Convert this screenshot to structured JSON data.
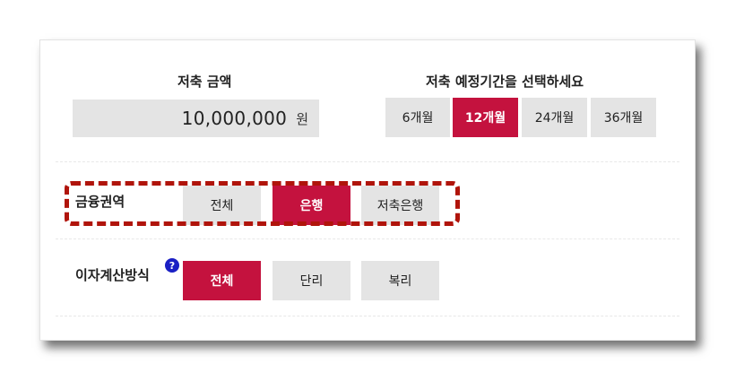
{
  "amount_section": {
    "title": "저축 금액",
    "value": "10,000,000",
    "unit": "원"
  },
  "period_section": {
    "title": "저축 예정기간을 선택하세요",
    "options": [
      "6개월",
      "12개월",
      "24개월",
      "36개월"
    ],
    "selected": "12개월"
  },
  "finance_area": {
    "label": "금융권역",
    "options": [
      "전체",
      "은행",
      "저축은행"
    ],
    "selected": "은행"
  },
  "interest_method": {
    "label": "이자계산방식",
    "help_icon": "?",
    "options": [
      "전체",
      "단리",
      "복리"
    ],
    "selected": "전체"
  },
  "colors": {
    "accent": "#c4123e",
    "button_bg": "#e4e4e4",
    "highlight_border": "#b0140b",
    "help_icon": "#1a1fc4"
  }
}
